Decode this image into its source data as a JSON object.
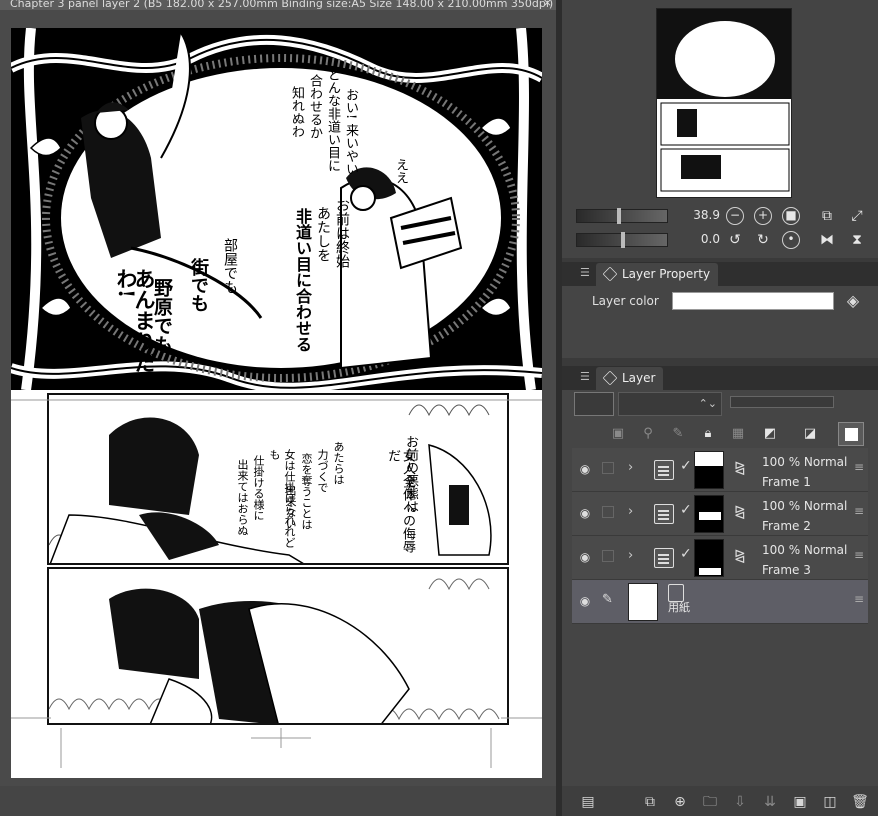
{
  "document": {
    "tab_title": "Chapter 3 panel layer 2 (B5 182.00 x 257.00mm Binding size:A5 Size 148.00 x 210.00mm 350dpi)",
    "close_symbol": "×"
  },
  "manga_text": {
    "panel1": [
      "ええ",
      "お前は終始",
      "あたしを",
      "非道い目に合わせる",
      "おい! 来いやい",
      "どんな非道い目に",
      "合わせるか",
      "知れぬわ",
      "部屋でも",
      "街でも",
      "野原でも",
      "あんまりだわ!"
    ],
    "panel2": [
      "お前の悪態は",
      "女人全体への侮辱だ",
      "あたらは",
      "力づくで",
      "恋を奪うことは",
      "出来ない",
      "女は仕掛けられれども",
      "仕掛ける様に",
      "出来てはおらぬ"
    ]
  },
  "navigator": {
    "zoom_value": "38.9",
    "rotate_value": "0.0",
    "icons": [
      "zoom-out-icon",
      "zoom-in-icon",
      "fit-icon",
      "fit-screen-icon",
      "fit-width-icon",
      "rotate-left-icon",
      "rotate-right-icon",
      "reset-rotation-icon",
      "flip-horizontal-icon",
      "flip-vertical-icon"
    ]
  },
  "layer_property": {
    "tab_label": "Layer Property",
    "layer_color_label": "Layer color",
    "layer_color_value": "#ffffff"
  },
  "layer_panel": {
    "tab_label": "Layer",
    "layers": [
      {
        "opacity_mode": "100 % Normal",
        "name": "Frame 1"
      },
      {
        "opacity_mode": "100 % Normal",
        "name": "Frame 2"
      },
      {
        "opacity_mode": "100 % Normal",
        "name": "Frame 3"
      }
    ],
    "paper_layer": {
      "name": "用紙"
    }
  },
  "colors": {
    "panel_bg": "#454545",
    "selected_layer": "#5e5e66",
    "accent_white": "#ffffff"
  }
}
